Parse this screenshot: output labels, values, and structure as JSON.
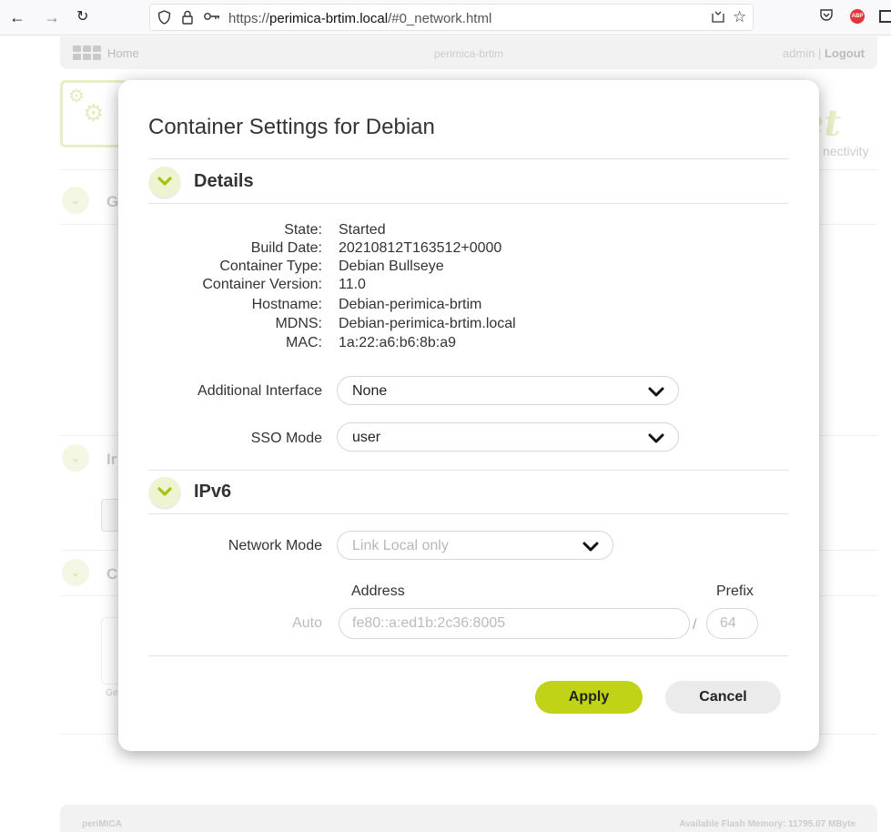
{
  "browser": {
    "url_prefix": "https://",
    "url_domain": "perimica-brtim.local",
    "url_path": "/#0_network.html",
    "icons": [
      "back-icon",
      "forward-icon",
      "reload-icon",
      "shield-icon",
      "lock-icon",
      "key-icon",
      "reader-mode-icon",
      "bookmark-star-icon",
      "pocket-icon",
      "adblock-icon",
      "menu-icon"
    ],
    "adblock_label": "ABP"
  },
  "app": {
    "home_label": "Home",
    "device_name": "perimica-brtim",
    "user": "admin",
    "separator": " | ",
    "logout_label": "Logout",
    "brand_fragment": "et",
    "tagline_fragment": "nectivity",
    "bg_sections": [
      "G",
      "Ir",
      "C"
    ],
    "bg_card_label": "Ge",
    "footer_left": "periMICA",
    "footer_right": "Available Flash Memory: 11795.07 MByte"
  },
  "modal": {
    "title": "Container Settings for Debian",
    "details_title": "Details",
    "details": [
      {
        "label": "State:",
        "value": "Started"
      },
      {
        "label": "Build Date:",
        "value": "20210812T163512+0000"
      },
      {
        "label": "Container Type:",
        "value": "Debian Bullseye"
      },
      {
        "label": "Container Version:",
        "value": "11.0"
      },
      {
        "label": "Hostname:",
        "value": "Debian-perimica-brtim"
      },
      {
        "label": "MDNS:",
        "value": "Debian-perimica-brtim.local"
      },
      {
        "label": "MAC:",
        "value": "1a:22:a6:b6:8b:a9"
      }
    ],
    "additional_interface": {
      "label": "Additional Interface",
      "value": "None"
    },
    "sso_mode": {
      "label": "SSO Mode",
      "value": "user"
    },
    "ipv6_title": "IPv6",
    "network_mode": {
      "label": "Network Mode",
      "value": "Link Local only",
      "disabled": true
    },
    "address_header": "Address",
    "prefix_header": "Prefix",
    "auto_label": "Auto",
    "address_value": "fe80::a:ed1b:2c36:8005",
    "prefix_value": "64",
    "prefix_separator": "/",
    "apply_label": "Apply",
    "cancel_label": "Cancel"
  },
  "colors": {
    "accent": "#c0d316",
    "chevron": "#a8c010",
    "chevron_bg": "#eef4d2"
  }
}
